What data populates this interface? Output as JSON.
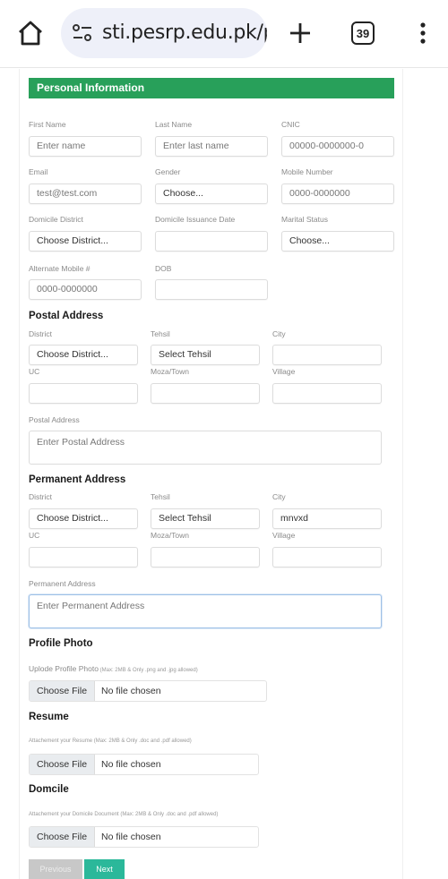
{
  "browser": {
    "url": "sti.pesrp.edu.pk/p",
    "tab_count": "39",
    "icons": {
      "home": "home-icon",
      "site_settings": "tune-icon",
      "new_tab": "plus-icon",
      "tabs": "tab-switcher-icon",
      "menu": "more-vert-icon"
    }
  },
  "form": {
    "section_title": "Personal Information",
    "colors": {
      "section_header": "#28a05a",
      "next_button": "#2bb89a",
      "previous_button": "#c8c8c8",
      "focus_border": "#9ec0e6"
    },
    "personal": {
      "first_name": {
        "label": "First Name",
        "placeholder": "Enter name"
      },
      "last_name": {
        "label": "Last Name",
        "placeholder": "Enter last name"
      },
      "cnic": {
        "label": "CNIC",
        "placeholder": "00000-0000000-0"
      },
      "email": {
        "label": "Email",
        "placeholder": "test@test.com"
      },
      "gender": {
        "label": "Gender",
        "selected": "Choose..."
      },
      "mobile": {
        "label": "Mobile Number",
        "placeholder": "0000-0000000"
      },
      "domicile_district": {
        "label": "Domicile District",
        "selected": "Choose District..."
      },
      "domicile_issuance_date": {
        "label": "Domicile Issuance Date",
        "value": ""
      },
      "marital_status": {
        "label": "Marital Status",
        "selected": "Choose..."
      },
      "alternate_mobile": {
        "label": "Alternate Mobile #",
        "placeholder": "0000-0000000"
      },
      "dob": {
        "label": "DOB",
        "value": ""
      }
    },
    "postal_address": {
      "heading": "Postal Address",
      "district": {
        "label": "District",
        "selected": "Choose District..."
      },
      "tehsil": {
        "label": "Tehsil",
        "selected": "Select Tehsil"
      },
      "city": {
        "label": "City",
        "value": ""
      },
      "uc": {
        "label": "UC",
        "value": ""
      },
      "moza_town": {
        "label": "Moza/Town",
        "value": ""
      },
      "village": {
        "label": "Village",
        "value": ""
      },
      "address": {
        "label": "Postal Address",
        "placeholder": "Enter Postal Address"
      }
    },
    "permanent_address": {
      "heading": "Permanent Address",
      "district": {
        "label": "District",
        "selected": "Choose District..."
      },
      "tehsil": {
        "label": "Tehsil",
        "selected": "Select Tehsil"
      },
      "city": {
        "label": "City",
        "value": "mnvxd"
      },
      "uc": {
        "label": "UC",
        "value": ""
      },
      "moza_town": {
        "label": "Moza/Town",
        "value": ""
      },
      "village": {
        "label": "Village",
        "value": ""
      },
      "address": {
        "label": "Permanent Address",
        "placeholder": "Enter Permanent Address"
      }
    },
    "profile_photo": {
      "heading": "Profile Photo",
      "label": "Uplode Profile Photo",
      "hint": "(Max: 2MB & Only .png and .jpg allowed)",
      "button": "Choose File",
      "status": "No file chosen"
    },
    "resume": {
      "heading": "Resume",
      "hint": "Attachement your Resume (Max: 2MB & Only .doc and .pdf allowed)",
      "button": "Choose File",
      "status": "No file chosen"
    },
    "domicile": {
      "heading": "Domcile",
      "hint": "Attachement your Domicile Document (Max: 2MB & Only .doc and .pdf allowed)",
      "button": "Choose File",
      "status": "No file chosen"
    },
    "buttons": {
      "previous": "Previous",
      "next": "Next"
    }
  }
}
